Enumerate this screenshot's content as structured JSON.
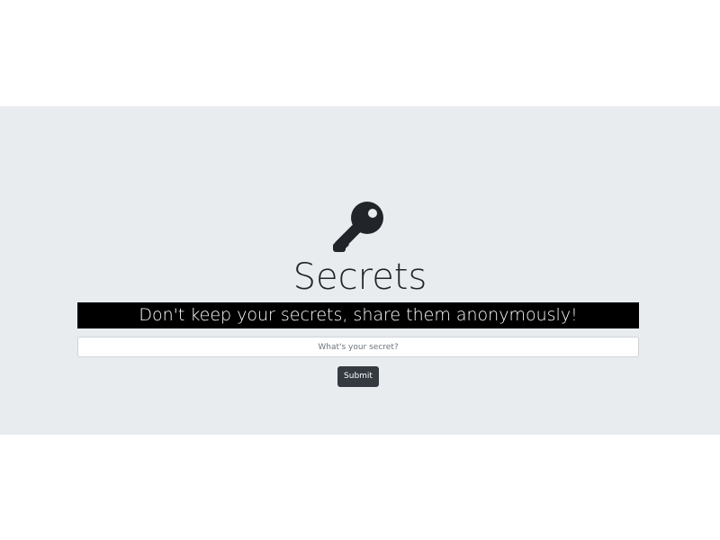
{
  "hero": {
    "icon": "key-icon",
    "title": "Secrets",
    "tagline": "Don't keep your secrets, share them anonymously!"
  },
  "form": {
    "secret_placeholder": "What's your secret?",
    "submit_label": "Submit"
  },
  "colors": {
    "jumbotron_bg": "#e9ecef",
    "tagline_bg": "#000000",
    "tagline_text": "#ffffff",
    "button_bg": "#343a40",
    "icon": "#212529"
  }
}
